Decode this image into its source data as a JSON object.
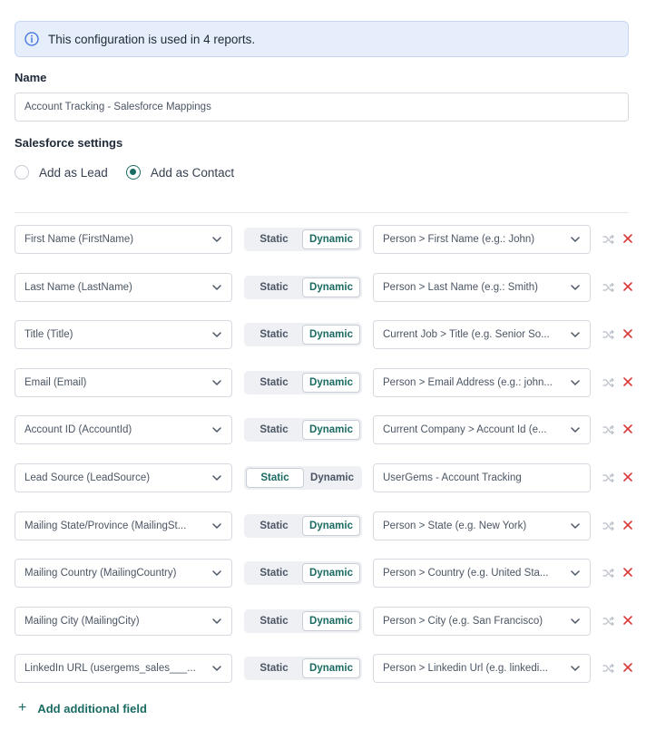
{
  "banner": {
    "text": "This configuration is used in 4 reports."
  },
  "name": {
    "label": "Name",
    "value": "Account Tracking - Salesforce Mappings"
  },
  "salesforce": {
    "label": "Salesforce settings",
    "options": [
      {
        "label": "Add as Lead",
        "checked": false
      },
      {
        "label": "Add as Contact",
        "checked": true
      }
    ]
  },
  "toggle": {
    "static_label": "Static",
    "dynamic_label": "Dynamic"
  },
  "mappings": [
    {
      "field": "First Name (FirstName)",
      "mode": "dynamic",
      "value": "Person > First Name (e.g.: John)"
    },
    {
      "field": "Last Name (LastName)",
      "mode": "dynamic",
      "value": "Person > Last Name (e.g.: Smith)"
    },
    {
      "field": "Title (Title)",
      "mode": "dynamic",
      "value": "Current Job > Title (e.g. Senior So..."
    },
    {
      "field": "Email (Email)",
      "mode": "dynamic",
      "value": "Person > Email Address (e.g.: john..."
    },
    {
      "field": "Account ID (AccountId)",
      "mode": "dynamic",
      "value": "Current Company > Account Id (e..."
    },
    {
      "field": "Lead Source (LeadSource)",
      "mode": "static",
      "value": "UserGems - Account Tracking"
    },
    {
      "field": "Mailing State/Province (MailingSt...",
      "mode": "dynamic",
      "value": "Person > State (e.g. New York)"
    },
    {
      "field": "Mailing Country (MailingCountry)",
      "mode": "dynamic",
      "value": "Person > Country (e.g. United Sta..."
    },
    {
      "field": "Mailing City (MailingCity)",
      "mode": "dynamic",
      "value": "Person > City (e.g. San Francisco)"
    },
    {
      "field": "LinkedIn URL (usergems_sales___...",
      "mode": "dynamic",
      "value": "Person > Linkedin Url (e.g. linkedi..."
    }
  ],
  "add_field": {
    "label": "Add additional field"
  },
  "colors": {
    "accent": "#1a6b62",
    "remove": "#d93a3a",
    "banner_bg": "#e6eefb",
    "info": "#3b6fd8"
  }
}
